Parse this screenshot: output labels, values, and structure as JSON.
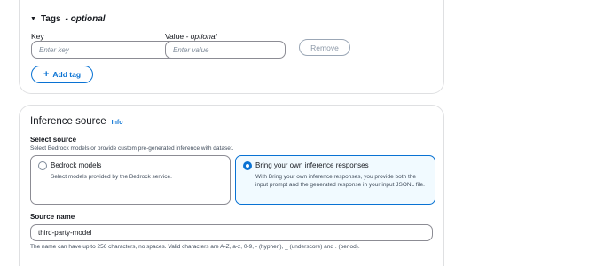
{
  "tags": {
    "header": "Tags",
    "header_optional": "- optional",
    "key_label": "Key",
    "value_label": "Value",
    "value_optional": "- optional",
    "key_placeholder": "Enter key",
    "value_placeholder": "Enter value",
    "remove_label": "Remove",
    "add_tag_label": "Add tag"
  },
  "inference": {
    "title": "Inference source",
    "info_label": "Info",
    "select_label": "Select source",
    "select_description": "Select Bedrock models or provide custom pre-generated inference with dataset.",
    "options": [
      {
        "title": "Bedrock models",
        "description": "Select models provided by the Bedrock service.",
        "selected": false
      },
      {
        "title": "Bring your own inference responses",
        "description": "With Bring your own inference responses, you provide both the input prompt and the generated response in your input JSONL file.",
        "selected": true
      }
    ],
    "source_name_label": "Source name",
    "source_name_value": "third-party-model",
    "source_name_hint": "The name can have up to 256 characters, no spaces. Valid characters are A-Z, a-z, 0-9, - (hyphen), _ (underscore) and . (period)."
  },
  "colors": {
    "accent": "#0972d3",
    "border": "#8c8c94",
    "selected_bg": "#f1faff"
  }
}
